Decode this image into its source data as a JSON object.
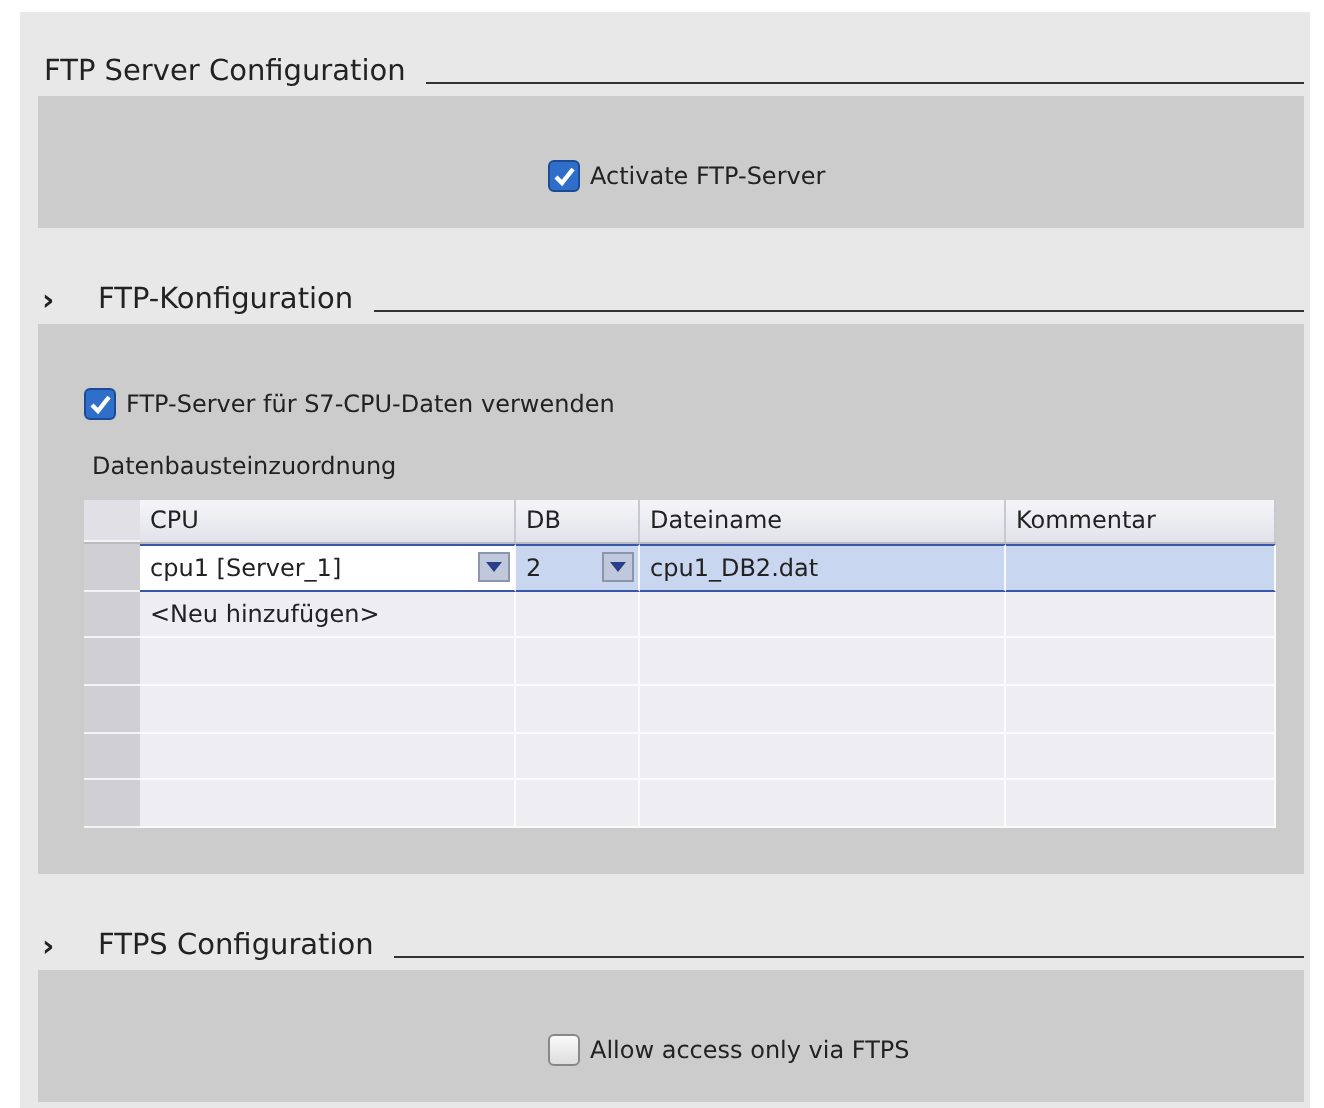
{
  "sections": [
    {
      "title": "FTP Server Configuration",
      "checkbox": {
        "label": "Activate FTP-Server",
        "checked": true
      }
    },
    {
      "title": "FTP-Konfiguration",
      "expander": "›",
      "checkbox": {
        "label": "FTP-Server für S7-CPU-Daten verwenden",
        "checked": true
      },
      "table_title": "Datenbausteinzuordnung",
      "table": {
        "columns": [
          "CPU",
          "DB",
          "Dateiname",
          "Kommentar"
        ],
        "rows": [
          {
            "selected": true,
            "cells": [
              {
                "text": "cpu1 [Server_1]",
                "dropdown": true
              },
              {
                "text": "2",
                "dropdown": true
              },
              {
                "text": "cpu1_DB2.dat",
                "dropdown": false
              }
            ]
          },
          {
            "selected": false,
            "cells": [
              {
                "text": "<Neu hinzufügen>",
                "dropdown": false
              }
            ]
          }
        ]
      }
    },
    {
      "title": "FTPS Configuration",
      "expander": "›",
      "checkbox": {
        "label": "Allow access only via FTPS",
        "checked": false
      }
    }
  ]
}
